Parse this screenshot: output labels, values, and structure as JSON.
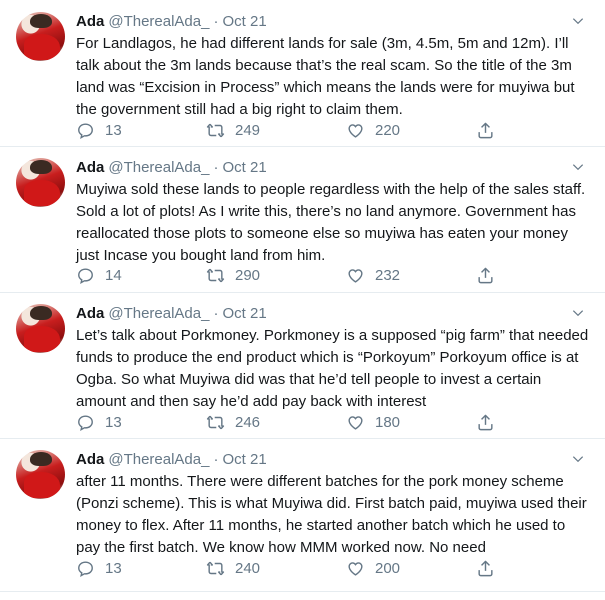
{
  "tweets": [
    {
      "name": "Ada",
      "handle": "@TherealAda_",
      "separator": "·",
      "date": "Oct 21",
      "text": "For Landlagos, he had different lands for sale (3m, 4.5m, 5m and 12m). I’ll talk about the 3m lands because that’s the real scam. So the title of the 3m land was “Excision in Process” which means the lands were for muyiwa but the government still had a big right to claim them.",
      "replies": "13",
      "retweets": "249",
      "likes": "220"
    },
    {
      "name": "Ada",
      "handle": "@TherealAda_",
      "separator": "·",
      "date": "Oct 21",
      "text": "Muyiwa sold these lands to people regardless with the help of the sales staff. Sold a lot of plots! As I write this, there’s no land anymore. Government has reallocated those plots to someone else so muyiwa has eaten your money just Incase you bought land from him.",
      "replies": "14",
      "retweets": "290",
      "likes": "232"
    },
    {
      "name": "Ada",
      "handle": "@TherealAda_",
      "separator": "·",
      "date": "Oct 21",
      "text": "Let’s talk about Porkmoney. Porkmoney is a supposed “pig farm” that needed funds to produce the end product which is “Porkoyum” Porkoyum office is at Ogba. So what Muyiwa did was that he’d tell people to invest a certain amount and then say he’d add pay back with interest",
      "replies": "13",
      "retweets": "246",
      "likes": "180"
    },
    {
      "name": "Ada",
      "handle": "@TherealAda_",
      "separator": "·",
      "date": "Oct 21",
      "text": "after 11 months. There were different batches for the pork money scheme (Ponzi scheme). This is what Muyiwa did. First batch paid, muyiwa used their money to flex. After 11 months, he started another batch which he used to pay the first batch. We know how MMM worked now. No need",
      "replies": "13",
      "retweets": "240",
      "likes": "200"
    }
  ],
  "icons": {
    "reply": "reply-icon",
    "retweet": "retweet-icon",
    "like": "like-icon",
    "share": "share-icon",
    "menu": "chevron-down-icon"
  },
  "colors": {
    "text": "#14171a",
    "muted": "#657786",
    "divider": "#e6ecf0"
  }
}
